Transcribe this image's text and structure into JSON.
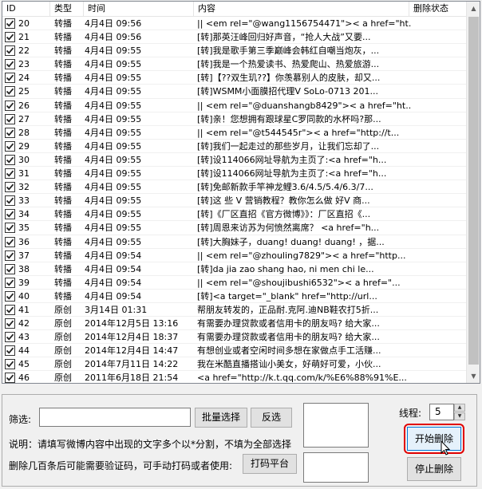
{
  "columns": {
    "id": "ID",
    "type": "类型",
    "time": "时间",
    "content": "内容",
    "delete_status": "删除状态"
  },
  "rows": [
    {
      "id": "20",
      "type": "转播",
      "time": "4月4日 09:56",
      "content": "|| <em rel=\"@wang1156754471\">< a href=\"ht...",
      "checked": true
    },
    {
      "id": "21",
      "type": "转播",
      "time": "4月4日 09:56",
      "content": "[转]那英汪峰回归好声音，“抢人大战”又要...",
      "checked": true
    },
    {
      "id": "22",
      "type": "转播",
      "time": "4月4日 09:55",
      "content": "[转]我是歌手第三季巅峰会韩红自嘲当炮灰，...",
      "checked": true
    },
    {
      "id": "23",
      "type": "转播",
      "time": "4月4日 09:55",
      "content": "[转]我是一个热爱读书、热爱爬山、热爱旅游...",
      "checked": true
    },
    {
      "id": "24",
      "type": "转播",
      "time": "4月4日 09:55",
      "content": "[转]【??双生玑??】你羡慕别人的皮肤，却又...",
      "checked": true
    },
    {
      "id": "25",
      "type": "转播",
      "time": "4月4日 09:55",
      "content": "[转]WSMM小面膜招代理V SoLo-0713       201...",
      "checked": true
    },
    {
      "id": "26",
      "type": "转播",
      "time": "4月4日 09:55",
      "content": "|| <em rel=\"@duanshangb8429\">< a href=\"ht...",
      "checked": true
    },
    {
      "id": "27",
      "type": "转播",
      "time": "4月4日 09:55",
      "content": "[转]亲！您想拥有跟球星C罗同款的水杯吗?那...",
      "checked": true
    },
    {
      "id": "28",
      "type": "转播",
      "time": "4月4日 09:55",
      "content": "|| <em rel=\"@t544545r\">< a href=\"http://t...",
      "checked": true
    },
    {
      "id": "29",
      "type": "转播",
      "time": "4月4日 09:55",
      "content": "[转]我们一起走过的那些岁月，让我们忘却了...",
      "checked": true
    },
    {
      "id": "30",
      "type": "转播",
      "time": "4月4日 09:55",
      "content": "[转]设114066网址导航为主页了:<a href=\"h...",
      "checked": true
    },
    {
      "id": "31",
      "type": "转播",
      "time": "4月4日 09:55",
      "content": "[转]设114066网址导航为主页了:<a href=\"h...",
      "checked": true
    },
    {
      "id": "32",
      "type": "转播",
      "time": "4月4日 09:55",
      "content": "[转]免邮新款手竿神龙鲤3.6/4.5/5.4/6.3/7...",
      "checked": true
    },
    {
      "id": "33",
      "type": "转播",
      "time": "4月4日 09:55",
      "content": "[转]这 些 V 营销教程？教你怎么做 好V 商...",
      "checked": true
    },
    {
      "id": "34",
      "type": "转播",
      "time": "4月4日 09:55",
      "content": "[转]《厂区直招《官方微博》》：厂区直招《...",
      "checked": true
    },
    {
      "id": "35",
      "type": "转播",
      "time": "4月4日 09:55",
      "content": "[转]周恩来访苏为何愤然离席？ <a href=\"h...",
      "checked": true
    },
    {
      "id": "36",
      "type": "转播",
      "time": "4月4日 09:55",
      "content": "[转]大胸妹子，duang! duang! duang! ，据...",
      "checked": true
    },
    {
      "id": "37",
      "type": "转播",
      "time": "4月4日 09:54",
      "content": "|| <em rel=\"@zhouling7829\">< a href=\"http...",
      "checked": true
    },
    {
      "id": "38",
      "type": "转播",
      "time": "4月4日 09:54",
      "content": "[转]da jia zao shang hao, ni men chi le...",
      "checked": true
    },
    {
      "id": "39",
      "type": "转播",
      "time": "4月4日 09:54",
      "content": "|| <em rel=\"@shoujibushi6532\">< a href=\"...",
      "checked": true
    },
    {
      "id": "40",
      "type": "转播",
      "time": "4月4日 09:54",
      "content": "[转]<a target=\"_blank\" href=\"http://url...",
      "checked": true
    },
    {
      "id": "41",
      "type": "原创",
      "time": "3月14日 01:31",
      "content": "帮朋友转发的，正品耐.克阿.迪NB鞋农打5折...",
      "checked": true
    },
    {
      "id": "42",
      "type": "原创",
      "time": "2014年12月5日 13:16",
      "content": "有需要办理贷款或者信用卡的朋友吗? 给大家...",
      "checked": true
    },
    {
      "id": "43",
      "type": "原创",
      "time": "2014年12月4日 18:37",
      "content": "有需要办理贷款或者信用卡的朋友吗? 给大家...",
      "checked": true
    },
    {
      "id": "44",
      "type": "原创",
      "time": "2014年12月4日 14:47",
      "content": "有想创业或者空闲时间多想在家做点手工活赚...",
      "checked": true
    },
    {
      "id": "45",
      "type": "原创",
      "time": "2014年7月11日 14:22",
      "content": "我在米酷直播搭讪小美女，好萌好可爱，小伙...",
      "checked": true
    },
    {
      "id": "46",
      "type": "原创",
      "time": "2011年6月18日 21:54",
      "content": "<a href=\"http://k.t.qq.com/k/%E6%88%91%E...",
      "checked": true
    }
  ],
  "filter": {
    "label": "筛选:",
    "value": "",
    "batch_select": "批量选择",
    "invert_select": "反选"
  },
  "help_text": "说明：请填写微博内容中出现的文字多个以*分割，不填为全部选择",
  "captcha_text": "删除几百条后可能需要验证码，可手动打码或者使用:",
  "captcha_button": "打码平台",
  "threads": {
    "label": "线程:",
    "value": "5"
  },
  "start_button": "开始删除",
  "stop_button": "停止删除",
  "colors": {
    "highlight": "#e00000",
    "border": "#adadad",
    "button_bg": "#e1e1e1"
  }
}
